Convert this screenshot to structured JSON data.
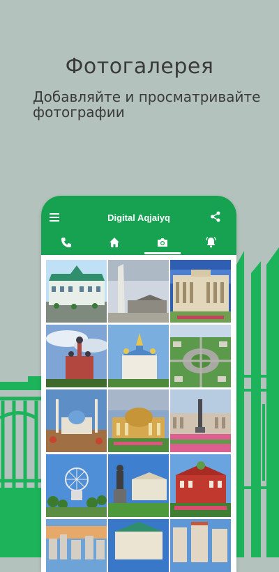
{
  "promo": {
    "title": "Фотогалерея",
    "subtitle": "Добавляйте и просматривайте фотографии"
  },
  "app": {
    "title": "Digital Aqjaiyq",
    "toolbar": {
      "menu_icon": "menu-icon",
      "share_icon": "share-icon"
    },
    "tabs": [
      {
        "icon": "phone-icon"
      },
      {
        "icon": "home-icon"
      },
      {
        "icon": "camera-icon",
        "selected": true
      },
      {
        "icon": "bell-icon"
      }
    ]
  },
  "colors": {
    "background": "#b3c2bd",
    "brand_green": "#17a251",
    "decor_green": "#1db35a"
  },
  "gallery": {
    "photos": [
      {
        "subject": "green-roofed mansion"
      },
      {
        "subject": "obelisk monument"
      },
      {
        "subject": "administration building"
      },
      {
        "subject": "cathedral with domes"
      },
      {
        "subject": "blue-roofed church"
      },
      {
        "subject": "park aerial view"
      },
      {
        "subject": "mosque with minarets"
      },
      {
        "subject": "theatre with yellow dome"
      },
      {
        "subject": "square with monument"
      },
      {
        "subject": "ferris wheel park"
      },
      {
        "subject": "statue and palace"
      },
      {
        "subject": "red brick building"
      },
      {
        "subject": "sunset city skyline"
      },
      {
        "subject": "green-roofed hall"
      },
      {
        "subject": "high-rise residences"
      }
    ]
  }
}
